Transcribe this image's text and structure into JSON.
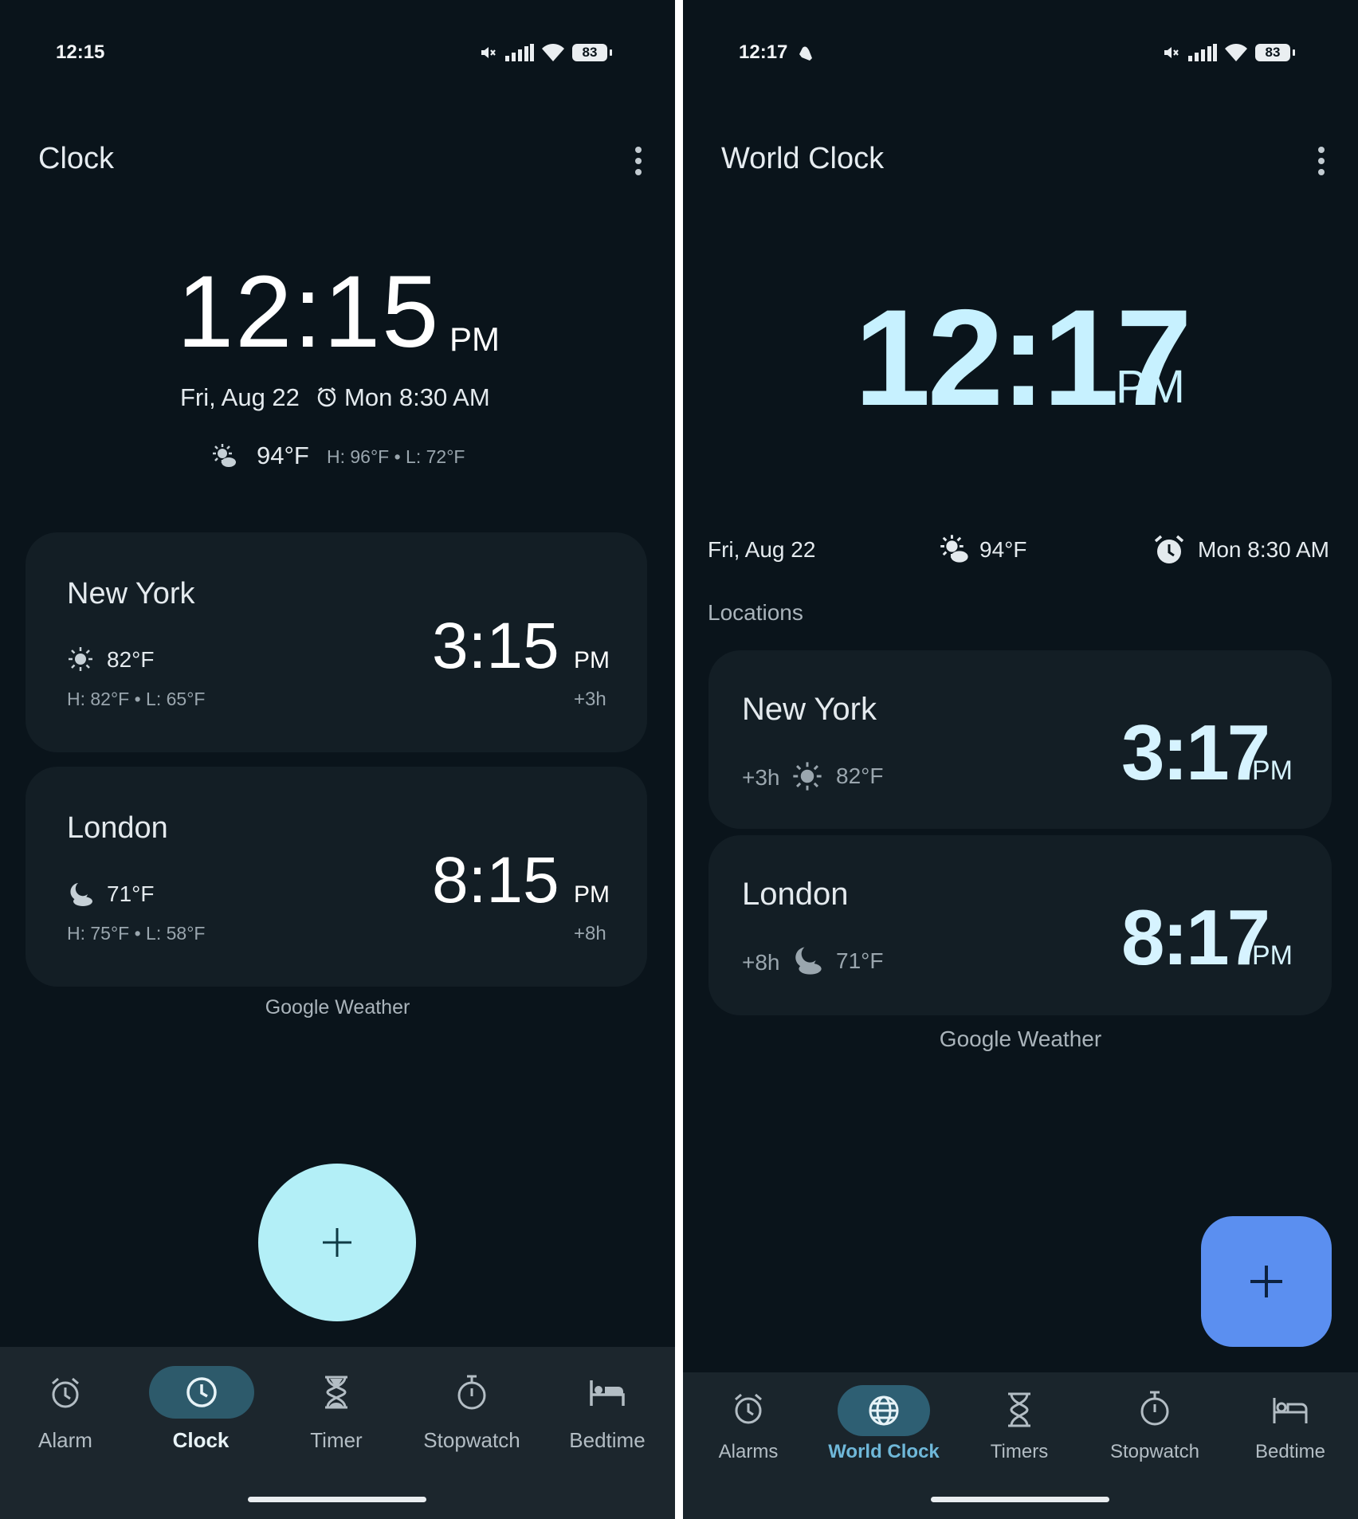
{
  "colors": {
    "background": "#0a141b",
    "card": "#131e25",
    "nav_background": "#1c262d",
    "left_fab": "#b3eff7",
    "right_fab": "#5b8ff0",
    "left_active_pill": "#2d5a6b",
    "right_active_pill": "#2e5f73",
    "right_clock_accent": "#c7f1ff"
  },
  "left": {
    "status": {
      "time": "12:15",
      "battery": "83"
    },
    "title": "Clock",
    "main_clock": {
      "time": "12:15",
      "ampm": "PM",
      "date": "Fri, Aug 22",
      "alarm": "Mon 8:30 AM"
    },
    "weather": {
      "temp": "94°F",
      "hilo": "H: 96°F • L: 72°F"
    },
    "cities": [
      {
        "name": "New York",
        "temp": "82°F",
        "hilo": "H: 82°F • L: 65°F",
        "time": "3:15",
        "ampm": "PM",
        "offset": "+3h",
        "icon": "sun-icon"
      },
      {
        "name": "London",
        "temp": "71°F",
        "hilo": "H: 75°F • L: 58°F",
        "time": "8:15",
        "ampm": "PM",
        "offset": "+8h",
        "icon": "moon-cloud-icon"
      }
    ],
    "attribution": "Google Weather",
    "fab_icon": "plus-icon",
    "nav": [
      {
        "label": "Alarm",
        "icon": "alarm-icon",
        "active": false
      },
      {
        "label": "Clock",
        "icon": "clock-icon",
        "active": true
      },
      {
        "label": "Timer",
        "icon": "hourglass-icon",
        "active": false
      },
      {
        "label": "Stopwatch",
        "icon": "stopwatch-icon",
        "active": false
      },
      {
        "label": "Bedtime",
        "icon": "bed-icon",
        "active": false
      }
    ]
  },
  "right": {
    "status": {
      "time": "12:17",
      "battery": "83"
    },
    "title": "World Clock",
    "main_clock": {
      "time": "12:17",
      "ampm": "PM",
      "date": "Fri, Aug 22",
      "temp": "94°F",
      "alarm": "Mon 8:30 AM"
    },
    "section_label": "Locations",
    "cities": [
      {
        "name": "New York",
        "offset": "+3h",
        "temp": "82°F",
        "time": "3:17",
        "ampm": "PM",
        "icon": "sun-icon"
      },
      {
        "name": "London",
        "offset": "+8h",
        "temp": "71°F",
        "time": "8:17",
        "ampm": "PM",
        "icon": "moon-cloud-icon"
      }
    ],
    "attribution": "Google Weather",
    "fab_icon": "plus-icon",
    "nav": [
      {
        "label": "Alarms",
        "icon": "alarm-icon",
        "active": false
      },
      {
        "label": "World Clock",
        "icon": "globe-icon",
        "active": true
      },
      {
        "label": "Timers",
        "icon": "hourglass-icon",
        "active": false
      },
      {
        "label": "Stopwatch",
        "icon": "stopwatch-icon",
        "active": false
      },
      {
        "label": "Bedtime",
        "icon": "bed-icon",
        "active": false
      }
    ]
  }
}
